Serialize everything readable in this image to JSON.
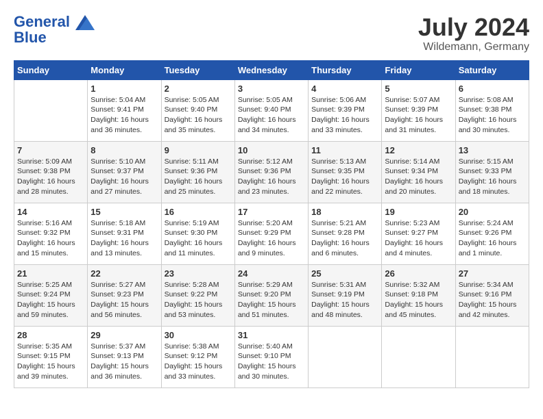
{
  "header": {
    "logo_line1": "General",
    "logo_line2": "Blue",
    "month": "July 2024",
    "location": "Wildemann, Germany"
  },
  "days_of_week": [
    "Sunday",
    "Monday",
    "Tuesday",
    "Wednesday",
    "Thursday",
    "Friday",
    "Saturday"
  ],
  "weeks": [
    [
      {
        "day": "",
        "content": ""
      },
      {
        "day": "1",
        "content": "Sunrise: 5:04 AM\nSunset: 9:41 PM\nDaylight: 16 hours\nand 36 minutes."
      },
      {
        "day": "2",
        "content": "Sunrise: 5:05 AM\nSunset: 9:40 PM\nDaylight: 16 hours\nand 35 minutes."
      },
      {
        "day": "3",
        "content": "Sunrise: 5:05 AM\nSunset: 9:40 PM\nDaylight: 16 hours\nand 34 minutes."
      },
      {
        "day": "4",
        "content": "Sunrise: 5:06 AM\nSunset: 9:39 PM\nDaylight: 16 hours\nand 33 minutes."
      },
      {
        "day": "5",
        "content": "Sunrise: 5:07 AM\nSunset: 9:39 PM\nDaylight: 16 hours\nand 31 minutes."
      },
      {
        "day": "6",
        "content": "Sunrise: 5:08 AM\nSunset: 9:38 PM\nDaylight: 16 hours\nand 30 minutes."
      }
    ],
    [
      {
        "day": "7",
        "content": "Sunrise: 5:09 AM\nSunset: 9:38 PM\nDaylight: 16 hours\nand 28 minutes."
      },
      {
        "day": "8",
        "content": "Sunrise: 5:10 AM\nSunset: 9:37 PM\nDaylight: 16 hours\nand 27 minutes."
      },
      {
        "day": "9",
        "content": "Sunrise: 5:11 AM\nSunset: 9:36 PM\nDaylight: 16 hours\nand 25 minutes."
      },
      {
        "day": "10",
        "content": "Sunrise: 5:12 AM\nSunset: 9:36 PM\nDaylight: 16 hours\nand 23 minutes."
      },
      {
        "day": "11",
        "content": "Sunrise: 5:13 AM\nSunset: 9:35 PM\nDaylight: 16 hours\nand 22 minutes."
      },
      {
        "day": "12",
        "content": "Sunrise: 5:14 AM\nSunset: 9:34 PM\nDaylight: 16 hours\nand 20 minutes."
      },
      {
        "day": "13",
        "content": "Sunrise: 5:15 AM\nSunset: 9:33 PM\nDaylight: 16 hours\nand 18 minutes."
      }
    ],
    [
      {
        "day": "14",
        "content": "Sunrise: 5:16 AM\nSunset: 9:32 PM\nDaylight: 16 hours\nand 15 minutes."
      },
      {
        "day": "15",
        "content": "Sunrise: 5:18 AM\nSunset: 9:31 PM\nDaylight: 16 hours\nand 13 minutes."
      },
      {
        "day": "16",
        "content": "Sunrise: 5:19 AM\nSunset: 9:30 PM\nDaylight: 16 hours\nand 11 minutes."
      },
      {
        "day": "17",
        "content": "Sunrise: 5:20 AM\nSunset: 9:29 PM\nDaylight: 16 hours\nand 9 minutes."
      },
      {
        "day": "18",
        "content": "Sunrise: 5:21 AM\nSunset: 9:28 PM\nDaylight: 16 hours\nand 6 minutes."
      },
      {
        "day": "19",
        "content": "Sunrise: 5:23 AM\nSunset: 9:27 PM\nDaylight: 16 hours\nand 4 minutes."
      },
      {
        "day": "20",
        "content": "Sunrise: 5:24 AM\nSunset: 9:26 PM\nDaylight: 16 hours\nand 1 minute."
      }
    ],
    [
      {
        "day": "21",
        "content": "Sunrise: 5:25 AM\nSunset: 9:24 PM\nDaylight: 15 hours\nand 59 minutes."
      },
      {
        "day": "22",
        "content": "Sunrise: 5:27 AM\nSunset: 9:23 PM\nDaylight: 15 hours\nand 56 minutes."
      },
      {
        "day": "23",
        "content": "Sunrise: 5:28 AM\nSunset: 9:22 PM\nDaylight: 15 hours\nand 53 minutes."
      },
      {
        "day": "24",
        "content": "Sunrise: 5:29 AM\nSunset: 9:20 PM\nDaylight: 15 hours\nand 51 minutes."
      },
      {
        "day": "25",
        "content": "Sunrise: 5:31 AM\nSunset: 9:19 PM\nDaylight: 15 hours\nand 48 minutes."
      },
      {
        "day": "26",
        "content": "Sunrise: 5:32 AM\nSunset: 9:18 PM\nDaylight: 15 hours\nand 45 minutes."
      },
      {
        "day": "27",
        "content": "Sunrise: 5:34 AM\nSunset: 9:16 PM\nDaylight: 15 hours\nand 42 minutes."
      }
    ],
    [
      {
        "day": "28",
        "content": "Sunrise: 5:35 AM\nSunset: 9:15 PM\nDaylight: 15 hours\nand 39 minutes."
      },
      {
        "day": "29",
        "content": "Sunrise: 5:37 AM\nSunset: 9:13 PM\nDaylight: 15 hours\nand 36 minutes."
      },
      {
        "day": "30",
        "content": "Sunrise: 5:38 AM\nSunset: 9:12 PM\nDaylight: 15 hours\nand 33 minutes."
      },
      {
        "day": "31",
        "content": "Sunrise: 5:40 AM\nSunset: 9:10 PM\nDaylight: 15 hours\nand 30 minutes."
      },
      {
        "day": "",
        "content": ""
      },
      {
        "day": "",
        "content": ""
      },
      {
        "day": "",
        "content": ""
      }
    ]
  ]
}
